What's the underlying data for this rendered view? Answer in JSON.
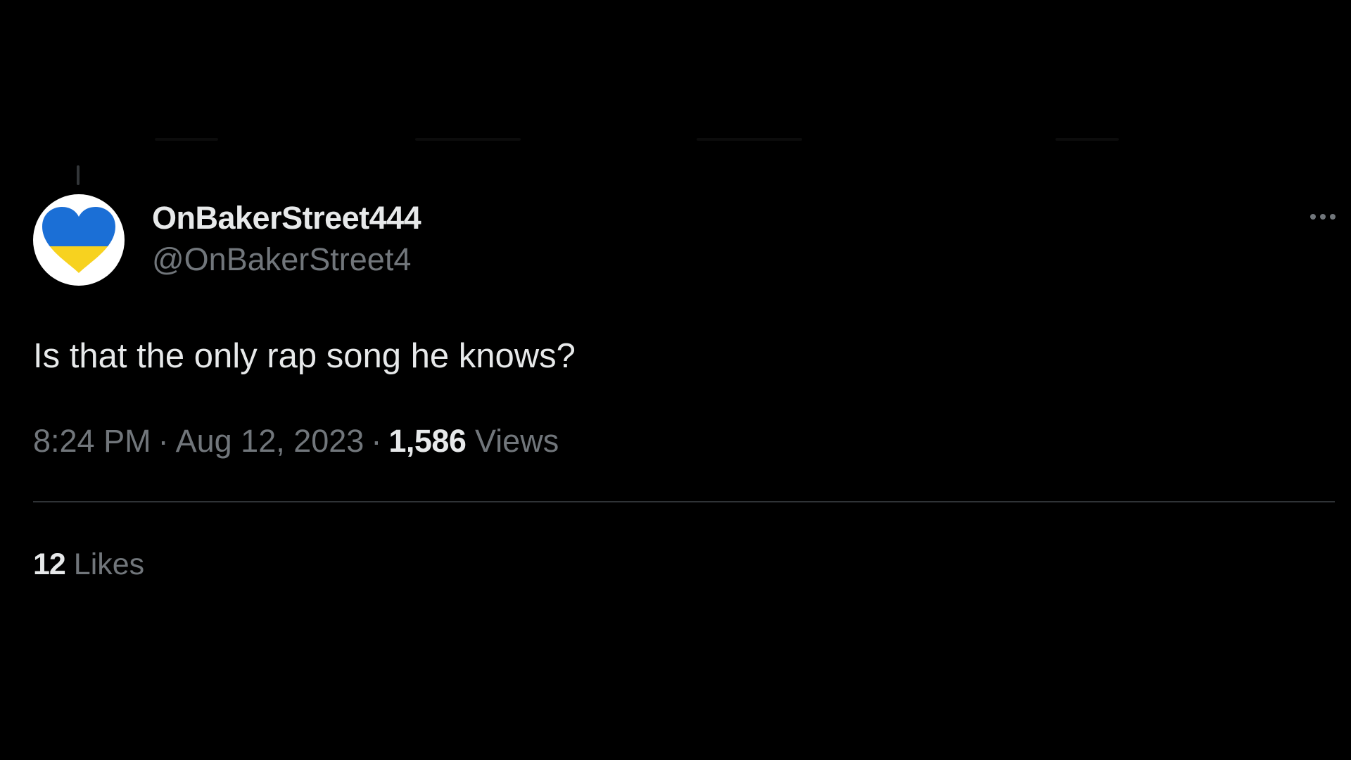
{
  "tweet": {
    "display_name": "OnBakerStreet444",
    "handle": "@OnBakerStreet4",
    "avatar_icon": "ukraine-heart-icon",
    "more_icon": "more-options-icon",
    "text": "Is that the only rap song he knows?",
    "time": "8:24 PM",
    "separator": "·",
    "date": "Aug 12, 2023",
    "views_count": "1,586",
    "views_label": "Views",
    "likes_count": "12",
    "likes_label": "Likes"
  },
  "colors": {
    "background": "#000000",
    "primary_text": "#e7e9ea",
    "secondary_text": "#71767b",
    "divider": "#2f3336",
    "heart_blue": "#1b6fd6",
    "heart_yellow": "#f7d21f"
  }
}
